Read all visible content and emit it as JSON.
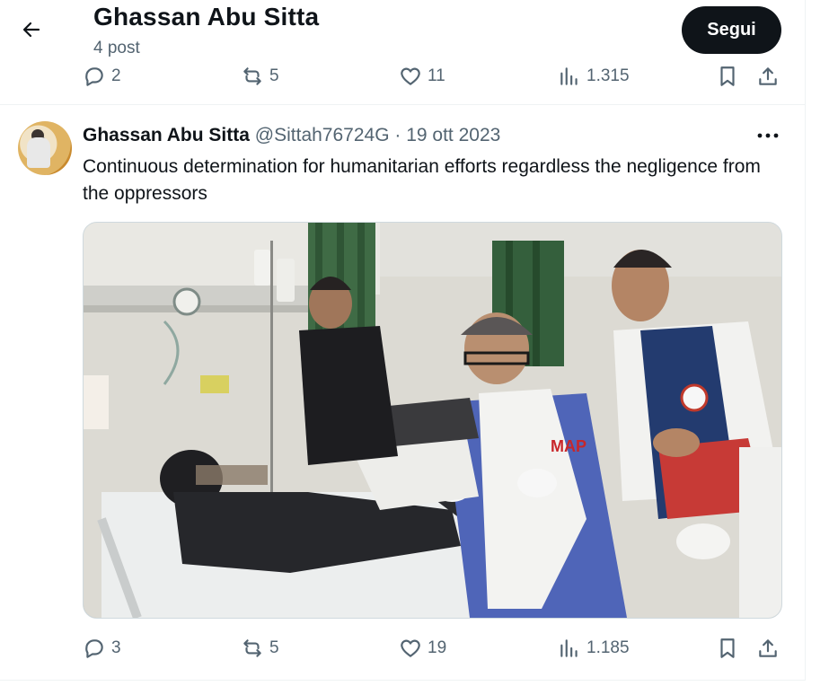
{
  "header": {
    "profile_name": "Ghassan Abu Sitta",
    "post_count": "4 post",
    "follow_label": "Segui"
  },
  "prev_tweet": {
    "replies": "2",
    "reposts": "5",
    "likes": "11",
    "views": "1.315"
  },
  "tweet": {
    "author_name": "Ghassan Abu Sitta",
    "handle": "@Sittah76724G",
    "separator": "·",
    "date": "19 ott 2023",
    "text": "Continuous determination for humanitarian efforts regardless the negligence from the oppressors",
    "media_vest_label": "MAP",
    "replies": "3",
    "reposts": "5",
    "likes": "19",
    "views": "1.185"
  },
  "colors": {
    "text_primary": "#0f1419",
    "text_secondary": "#536471",
    "follow_bg": "#0f1419",
    "divider": "#eff3f4"
  },
  "icons": [
    "back-arrow-icon",
    "reply-icon",
    "repost-icon",
    "like-icon",
    "views-icon",
    "bookmark-icon",
    "share-icon",
    "more-icon"
  ]
}
